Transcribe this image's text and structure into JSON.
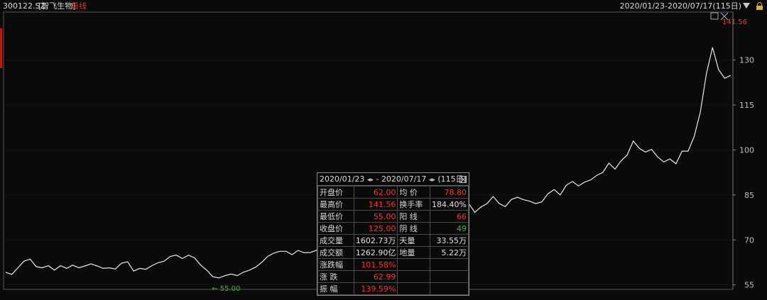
{
  "header": {
    "code": "300122.SZ",
    "name": "[智飞生物]",
    "period": "日线",
    "range": "2020/01/23-2020/07/17(115日)"
  },
  "icons": {
    "dropdown": "triangle-down-icon",
    "lock": "lock-icon",
    "window": "window-icon",
    "close": "close-icon"
  },
  "colors": {
    "up": "#ff3030",
    "down": "#30c030",
    "line": "#e8e8e8",
    "grid": "#3a3a3a",
    "background": "#0a0a0a"
  },
  "stats": {
    "header_start": "2020/01/23",
    "header_sep": "-",
    "header_end": "2020/07/17",
    "header_days": "(115日)",
    "rows": [
      {
        "label": "开盘价",
        "value": "62.00",
        "label2": "均  价",
        "value2": "78.80"
      },
      {
        "label": "最高价",
        "value": "141.56",
        "label2": "换手率",
        "value2": "184.40%"
      },
      {
        "label": "最低价",
        "value": "55.00",
        "label2": "阳  线",
        "value2": "66"
      },
      {
        "label": "收盘价",
        "value": "125.00",
        "label2": "阴  线",
        "value2": "49"
      },
      {
        "label": "成交量",
        "value": "1602.73万",
        "label2": "天量",
        "value2": "33.55万"
      },
      {
        "label": "成交额",
        "value": "1262.90亿",
        "label2": "地量",
        "value2": "5.22万"
      },
      {
        "label": "涨跌幅",
        "value": "101.58%",
        "label2": "",
        "value2": ""
      },
      {
        "label": "涨  跌",
        "value": "62.99",
        "label2": "",
        "value2": ""
      },
      {
        "label": "振  幅",
        "value": "139.59%",
        "label2": "",
        "value2": ""
      }
    ]
  },
  "chart_data": {
    "type": "line",
    "ylim": [
      53.5,
      146
    ],
    "yticks": [
      55,
      70,
      85,
      100,
      115,
      130
    ],
    "high_label": "141.56",
    "low_label": "55.00",
    "values": [
      59.2,
      58.5,
      60.7,
      62.9,
      63.6,
      61.1,
      60.7,
      61.4,
      59.9,
      61.4,
      60.5,
      61.6,
      60.7,
      61.3,
      62.0,
      61.3,
      60.5,
      60.7,
      60.3,
      62.2,
      62.7,
      59.6,
      60.5,
      60.2,
      61.4,
      62.4,
      62.9,
      64.5,
      64.9,
      63.8,
      64.9,
      64.0,
      61.6,
      59.9,
      57.7,
      57.3,
      58.1,
      58.6,
      58.1,
      59.2,
      59.9,
      60.9,
      62.5,
      64.5,
      65.6,
      66.2,
      66.2,
      65.1,
      66.5,
      65.7,
      65.8,
      66.5,
      68.4,
      67.8,
      71.3,
      72.8,
      74.2,
      74.9,
      76.2,
      77.1,
      77.8,
      78.4,
      78.9,
      79.5,
      80.4,
      81.1,
      82.1,
      82.5,
      84.3,
      83.5,
      84.5,
      85.5,
      87.7,
      86.9,
      83.5,
      81.8,
      82.1,
      79.2,
      81.0,
      82.1,
      84.5,
      82.1,
      81.1,
      83.5,
      84.2,
      83.4,
      82.9,
      82.1,
      82.7,
      85.4,
      86.8,
      85.0,
      88.2,
      89.5,
      88.0,
      89.3,
      90.0,
      91.5,
      92.5,
      95.6,
      93.6,
      96.4,
      98.3,
      103.0,
      100.5,
      99.3,
      100.2,
      97.7,
      96.0,
      97.0,
      95.4,
      99.6,
      99.6,
      104.5,
      112.6,
      125.5,
      134.2,
      126.8,
      123.9,
      124.9
    ]
  }
}
